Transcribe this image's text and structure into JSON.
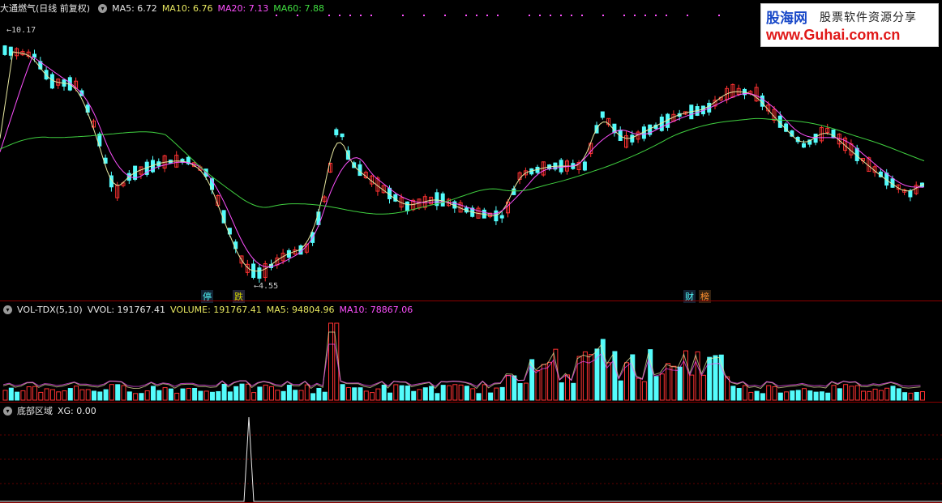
{
  "main": {
    "stock_name": "大通燃气(日线 前复权)",
    "ma5": "MA5: 6.72",
    "ma10": "MA10: 6.76",
    "ma20": "MA20: 7.13",
    "ma60": "MA60: 7.88",
    "high_label": "←10.17",
    "low_label": "←4.55",
    "tag_ting": "停",
    "tag_die": "跌",
    "tag_cai": "财",
    "tag_bang": "榜",
    "colors": {
      "up": "#ff3232",
      "down": "#54fcfc",
      "ma5": "#e8e8a0",
      "ma10": "#ff50ff",
      "ma20": "#e040e0",
      "ma60": "#40d040"
    }
  },
  "volume": {
    "name": "VOL-TDX(5,10)",
    "vvol": "VVOL: 191767.41",
    "volume": "VOLUME: 191767.41",
    "ma5": "MA5: 94804.96",
    "ma10": "MA10: 78867.06"
  },
  "indicator": {
    "name": "底部区域",
    "xg": "XG: 0.00"
  },
  "watermark": {
    "brand": "股海网",
    "slogan": "股票软件资源分享",
    "url": "www.Guhai.com.cn"
  }
}
